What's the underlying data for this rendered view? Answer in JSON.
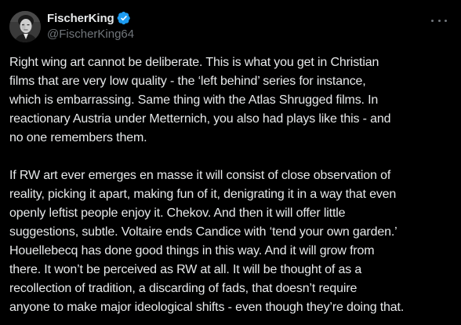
{
  "post": {
    "author": {
      "display_name": "FischerKing",
      "handle": "@FischerKing64",
      "verified": true,
      "verified_color": "#1d9bf0",
      "avatar_icon": "profile-photo"
    },
    "more_icon": "ellipsis-icon",
    "paragraphs": [
      {
        "lines": [
          "Right wing art cannot be deliberate. This is what you get in Christian",
          "films that are very low quality - the ‘left behind’ series for instance,",
          "which is embarrassing. Same thing with the Atlas Shrugged films. In",
          "reactionary Austria under Metternich, you also had plays like this - and",
          "no one remembers them."
        ]
      },
      {
        "lines": [
          "If RW art ever emerges en masse it will consist of close observation of",
          "reality, picking it apart, making fun of it, denigrating it in a way that even",
          "openly leftist people enjoy it. Chekov. And then it will offer little",
          "suggestions, subtle. Voltaire ends Candice with ‘tend your own garden.’",
          "Houellebecq has done good things in this way. And it will grow from",
          "there. It won’t be perceived as RW at all. It will be thought of as a",
          "recollection of tradition, a discarding of fads, that doesn’t require",
          "anyone to make major ideological shifts - even though they’re doing that."
        ]
      }
    ]
  },
  "colors": {
    "background": "#000000",
    "text_primary": "#e7e9ea",
    "text_secondary": "#71767b",
    "accent": "#1d9bf0"
  }
}
